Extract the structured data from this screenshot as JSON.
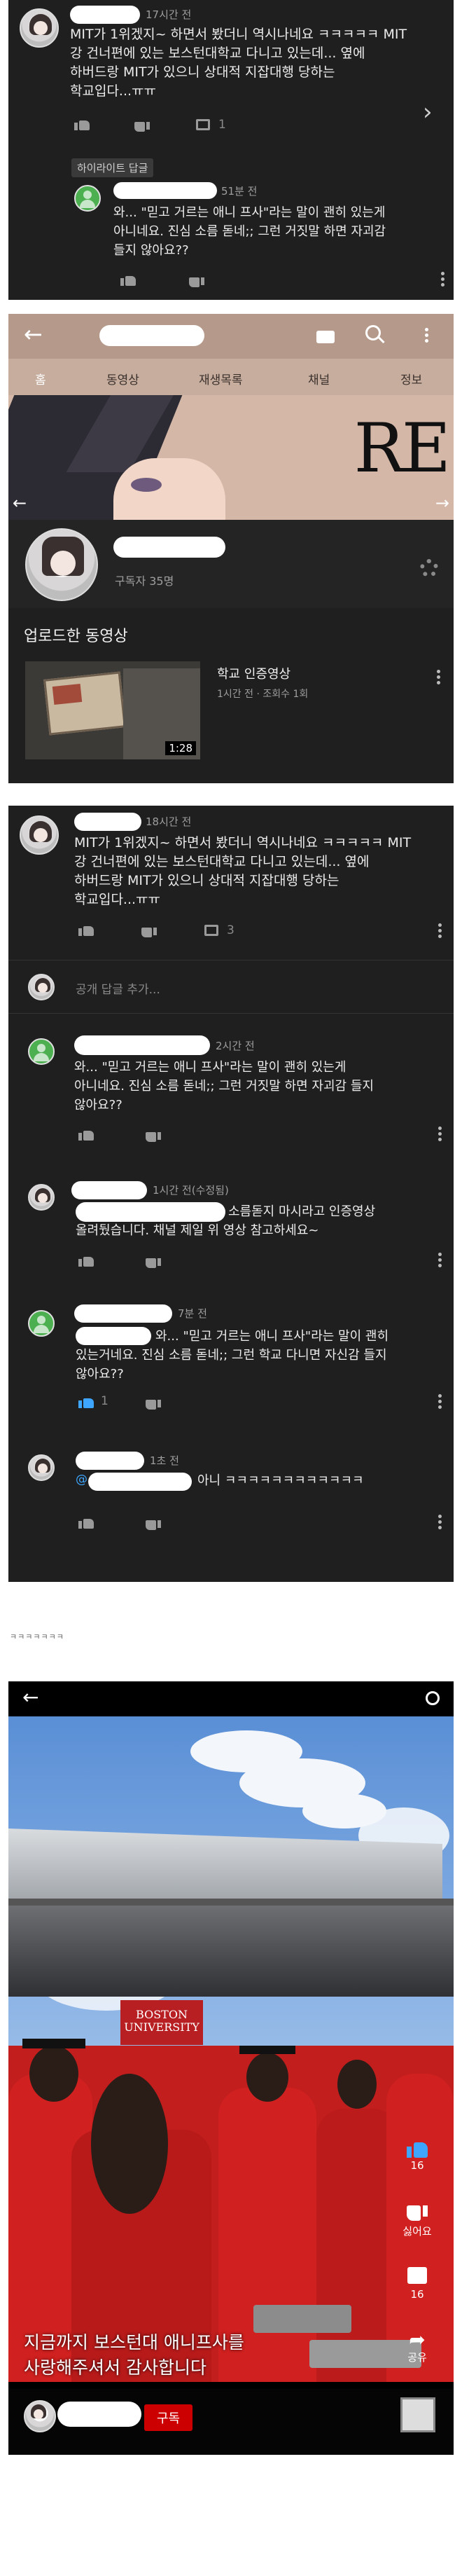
{
  "panel1": {
    "comment": {
      "time": "17시간 전",
      "text_line1": "MIT가 1위겠지~ 하면서 봤더니 역시나네요 ㅋㅋㅋㅋㅋ MIT",
      "text_line2": "강 건너편에 있는 보스턴대학교 다니고 있는데... 옆에",
      "text_line3": "하버드랑 MIT가 있으니 상대적 지잡대행 당하는",
      "text_line4": "학교입다...ㅠㅠ",
      "reply_count": "1"
    },
    "highlight_label": "하이라이트 답글",
    "reply": {
      "time": "51분 전",
      "text_line1": "와... \"믿고 거르는 애니 프사\"라는 말이 괜히 있는게",
      "text_line2": "아니네요. 진심 소름 돋네;; 그런 거짓말 하면 자괴감",
      "text_line3": "들지 않아요??"
    }
  },
  "panel2": {
    "tabs": [
      "홈",
      "동영상",
      "재생목록",
      "채널",
      "정보"
    ],
    "banner_text": "RE",
    "subscribers": "구독자 35명",
    "section_title": "업로드한 동영상",
    "video": {
      "title": "학교 인증영상",
      "meta": "1시간 전 · 조회수 1회",
      "duration": "1:28"
    }
  },
  "panel3": {
    "comment": {
      "time": "18시간 전",
      "text_line1": "MIT가 1위겠지~ 하면서 봤더니 역시나네요 ㅋㅋㅋㅋㅋ MIT",
      "text_line2": "강 건너편에 있는 보스턴대학교 다니고 있는데... 옆에",
      "text_line3": "하버드랑 MIT가 있으니 상대적 지잡대행 당하는",
      "text_line4": "학교입다...ㅠㅠ",
      "reply_count": "3"
    },
    "add_reply_placeholder": "공개 답글 추가...",
    "replies": [
      {
        "time": "2시간 전",
        "line1": "와... \"믿고 거르는 애니 프사\"라는 말이 괜히 있는게",
        "line2": "아니네요. 진심 소름 돋네;; 그런 거짓말 하면 자괴감 들지",
        "line3": "않아요??"
      },
      {
        "time": "1시간 전(수정됨)",
        "line1": "소름돋지 마시라고 인증영상",
        "line2": "올려뒀습니다. 채널 제일 위 영상 참고하세요~"
      },
      {
        "time": "7분 전",
        "line1": "와... \"믿고 거르는 애니 프사\"라는 말이 괜히",
        "line2": "있는거네요. 진심 소름 돋네;; 그런 학교 다니면 자신감 들지",
        "line3": "않아요??",
        "likes": "1"
      },
      {
        "time": "1초 전",
        "mention": "@",
        "line1": "아니 ㅋㅋㅋㅋㅋㅋㅋㅋㅋㅋㅋㅋ"
      }
    ]
  },
  "caption_small": "ㅋㅋㅋㅋㅋㅋㅋ",
  "panel4": {
    "sign_text": "BOSTON UNIVERSITY",
    "likes": "16",
    "dislike_label": "싫어요",
    "comments": "16",
    "share_label": "공유",
    "caption_line1": "지금까지 보스턴대 애니프사를",
    "caption_line2": "사랑해주셔서 감사합니다",
    "subscribe_label": "구독"
  },
  "colors": {
    "panel_bg": "#1f1f1f",
    "header_tan": "#b59a8c",
    "accent_blue": "#3ea6ff",
    "subscribe_red": "#cc0000"
  }
}
